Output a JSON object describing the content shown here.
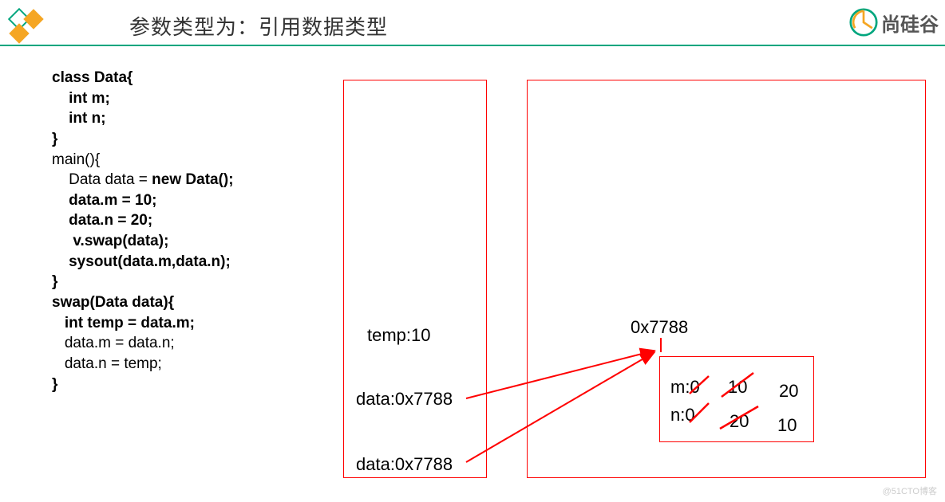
{
  "header": {
    "title": "参数类型为：引用数据类型",
    "logo_text": "尚硅谷"
  },
  "code": {
    "l1": "class Data{",
    "l2": "    int m;",
    "l3": "    int n;",
    "l4": "}",
    "l5": "",
    "l6": "",
    "l7": "main(){",
    "l8a": "    Data data = ",
    "l8b": "new Data();",
    "l9": "    data.m = 10;",
    "l10": "    data.n = 20;",
    "l11": "     v.swap(data);",
    "l12": "    sysout(data.m,data.n);",
    "l13": "}",
    "l14": "swap(Data data){",
    "l15": "   int temp = data.m;",
    "l16": "   data.m = data.n;",
    "l17": "   data.n = temp;",
    "l18": "}"
  },
  "stack": {
    "temp": "temp:10",
    "data1": "data:0x7788",
    "data2": "data:0x7788"
  },
  "heap": {
    "addr": "0x7788",
    "m_label": "m:0",
    "m_v1": "10",
    "m_v2": "20",
    "n_label": "n:0",
    "n_v1": "20",
    "n_v2": "10"
  },
  "watermark": "@51CTO博客"
}
